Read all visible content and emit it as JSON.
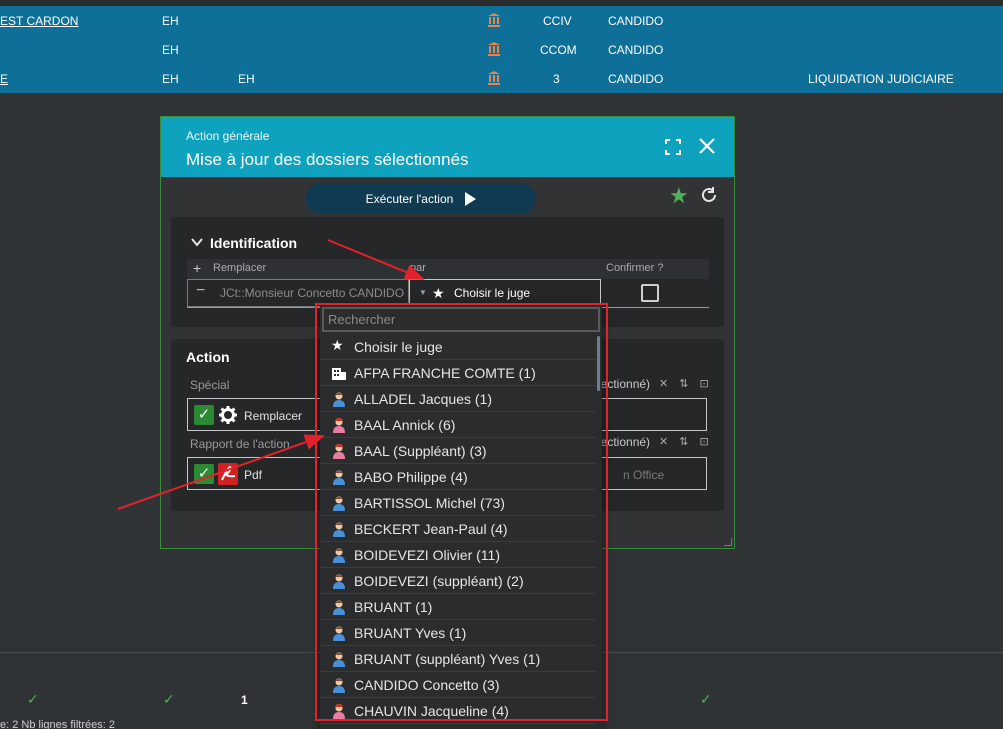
{
  "background_table": {
    "rows": [
      {
        "name": "EST CARDON",
        "col2": "EH",
        "col3": "",
        "code": "CCIV",
        "judge": "CANDIDO",
        "status": ""
      },
      {
        "name": "",
        "col2": "EH",
        "col3": "",
        "code": "CCOM",
        "judge": "CANDIDO",
        "status": ""
      },
      {
        "name": "E",
        "col2": "EH",
        "col3": "EH",
        "code": "3",
        "judge": "CANDIDO",
        "status": "LIQUIDATION JUDICIAIRE"
      }
    ],
    "bottom_row": {
      "check1": "✓",
      "check2": "✓",
      "count": "1",
      "check3": "✓"
    },
    "bottom_status": "e: 2   Nb lignes filtrées: 2"
  },
  "dialog": {
    "subtitle": "Action générale",
    "title": "Mise à jour des dossiers sélectionnés",
    "execute_label": "Exécuter l'action",
    "identification": {
      "title": "Identification",
      "columns": [
        "Remplacer",
        "par",
        "Confirmer ?"
      ],
      "remplacer_value": "JCt::Monsieur Concetto CANDIDO",
      "par_value": "Choisir le juge"
    },
    "action": {
      "title": "Action",
      "special_label": "Spécial",
      "special_value": "Remplacer",
      "special_side": "lectionné)",
      "rapport_label": "Rapport de l'action",
      "rapport_value": "Pdf",
      "rapport_side": "lectionné)",
      "rapport_right_text": "n Office"
    }
  },
  "dropdown": {
    "search_placeholder": "Rechercher",
    "items": [
      {
        "label": "Choisir le juge",
        "icon": "star-icon"
      },
      {
        "label": "AFPA FRANCHE COMTE (1)",
        "icon": "building-icon"
      },
      {
        "label": "ALLADEL Jacques (1)",
        "icon": "male-user-icon"
      },
      {
        "label": "BAAL Annick (6)",
        "icon": "female-user-icon"
      },
      {
        "label": "BAAL (Suppléant) (3)",
        "icon": "female-user-icon"
      },
      {
        "label": "BABO Philippe (4)",
        "icon": "male-user-icon"
      },
      {
        "label": "BARTISSOL Michel (73)",
        "icon": "male-user-icon"
      },
      {
        "label": "BECKERT Jean-Paul (4)",
        "icon": "male-user-icon"
      },
      {
        "label": "BOIDEVEZI Olivier (11)",
        "icon": "male-user-icon"
      },
      {
        "label": "BOIDEVEZI (suppléant) (2)",
        "icon": "male-user-icon"
      },
      {
        "label": "BRUANT (1)",
        "icon": "male-user-icon"
      },
      {
        "label": "BRUANT Yves (1)",
        "icon": "male-user-icon"
      },
      {
        "label": "BRUANT (suppléant) Yves (1)",
        "icon": "male-user-icon"
      },
      {
        "label": "CANDIDO Concetto (3)",
        "icon": "male-user-icon"
      },
      {
        "label": "CHAUVIN Jacqueline (4)",
        "icon": "female-user-icon"
      }
    ]
  },
  "colors": {
    "header_blue": "#0e6f99",
    "dialog_header": "#0fa2bf",
    "accent_green": "#4fb35a",
    "annotation_red": "#e2222a"
  }
}
